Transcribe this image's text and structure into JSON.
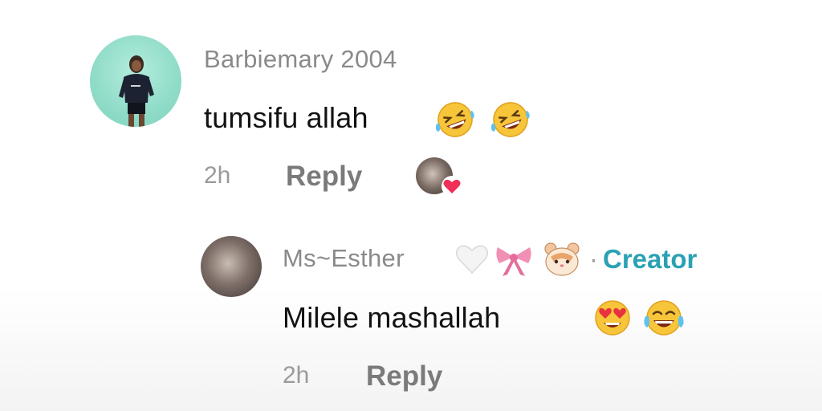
{
  "comment": {
    "author": "Barbiemary 2004",
    "text": "tumsifu allah",
    "emojis": [
      "rolling-on-floor-laughing",
      "rolling-on-floor-laughing"
    ],
    "time": "2h",
    "reply_label": "Reply",
    "liked_by_creator": true
  },
  "reply": {
    "author": "Ms~Esther",
    "author_emojis": [
      "white-heart",
      "ribbon",
      "hamster"
    ],
    "separator": "·",
    "badge": "Creator",
    "text": "Milele mashallah",
    "emojis": [
      "heart-eyes",
      "tears-of-joy"
    ],
    "time": "2h",
    "reply_label": "Reply"
  },
  "colors": {
    "creator_badge": "#2aa1b4",
    "author_gray": "#8a8a8a",
    "avatar_mint": "#8fdcc8",
    "like_heart": "#ef2f58"
  }
}
